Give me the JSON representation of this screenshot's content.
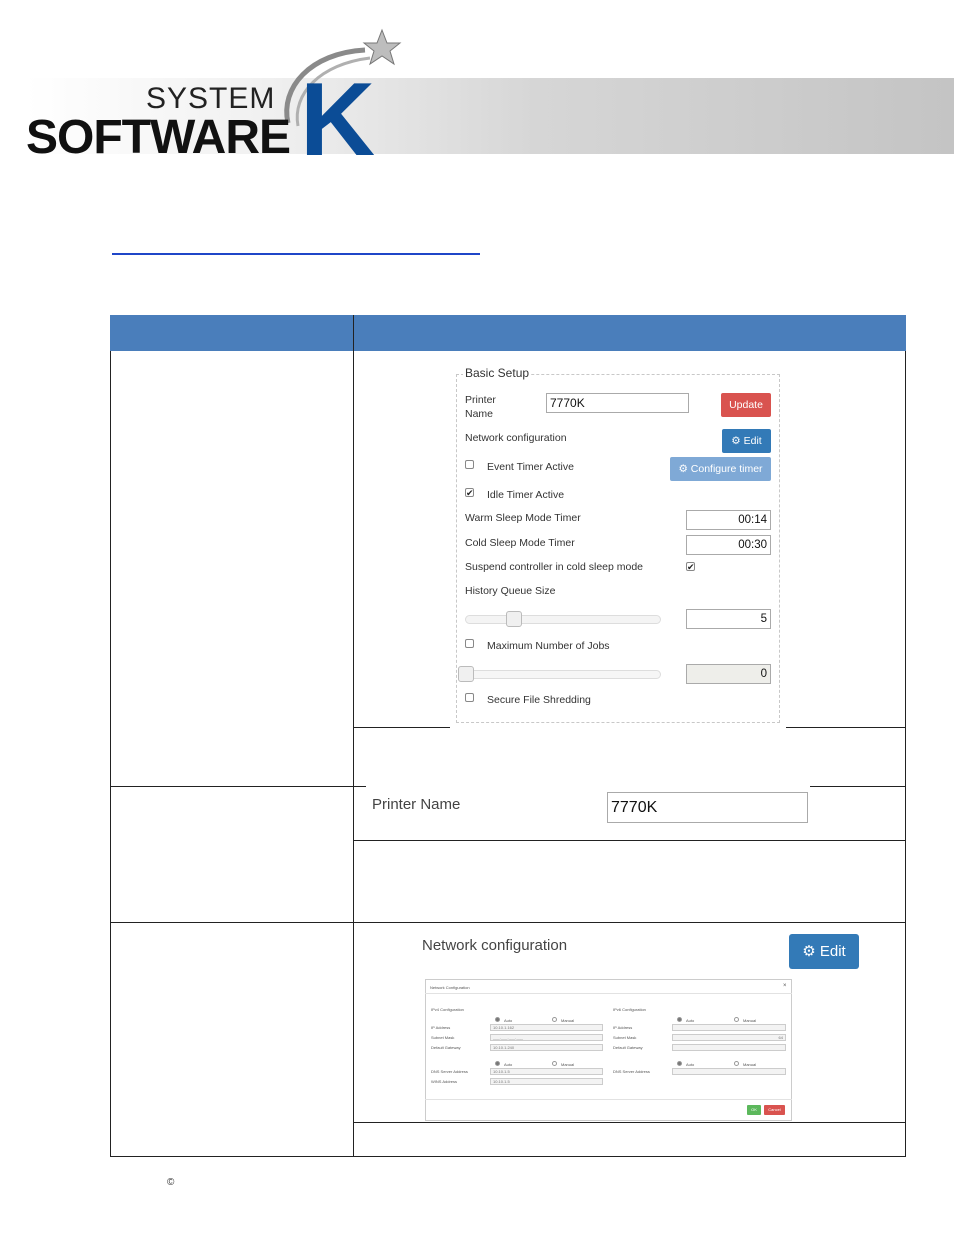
{
  "header": {
    "logo_system": "SYSTEM",
    "logo_software": "SOFTWARE",
    "logo_k": "K"
  },
  "basic_setup": {
    "legend": "Basic Setup",
    "printer_name_label": "Printer\nName",
    "printer_name_value": "7770K",
    "update_button": "Update",
    "network_config_label": "Network configuration",
    "edit_button": "Edit",
    "event_timer_label": "Event Timer Active",
    "event_timer_checked": false,
    "configure_timer_button": "Configure timer",
    "idle_timer_label": "Idle Timer Active",
    "idle_timer_checked": true,
    "warm_sleep_label": "Warm Sleep Mode Timer",
    "warm_sleep_value": "00:14",
    "cold_sleep_label": "Cold Sleep Mode Timer",
    "cold_sleep_value": "00:30",
    "suspend_label": "Suspend controller in cold sleep mode",
    "suspend_checked": true,
    "history_label": "History Queue Size",
    "history_value": "5",
    "history_slider_fraction": 0.25,
    "max_jobs_label": "Maximum Number of Jobs",
    "max_jobs_checked": false,
    "max_jobs_value": "0",
    "max_jobs_slider_fraction": 0.0,
    "secure_shred_label": "Secure File Shredding",
    "secure_shred_checked": false
  },
  "printer_name_zoom": {
    "label": "Printer Name",
    "value": "7770K"
  },
  "network_zoom": {
    "label": "Network configuration",
    "edit_button": "Edit",
    "dialog": {
      "title": "Network Configuration",
      "close": "×",
      "ipv4_heading": "IPv4 Configuration",
      "ipv6_heading": "IPv6 Configuration",
      "auto": "Auto",
      "manual": "Manual",
      "ip_address_label": "IP Address",
      "ip_address_value": "10.10.1.162",
      "subnet_label": "Subnet Mask",
      "subnet_value": "___.___.___.___",
      "gateway_label": "Default Gateway",
      "gateway_value": "10.10.1.240",
      "ipv6_prefix_value": "64",
      "dns_label": "DNS Server Address",
      "dns_value": "10.10.1.5",
      "wins_label": "WINS Address",
      "wins_value": "10.10.1.5",
      "ok_button": "OK",
      "cancel_button": "Cancel"
    }
  },
  "footer": {
    "copyright": "©"
  }
}
